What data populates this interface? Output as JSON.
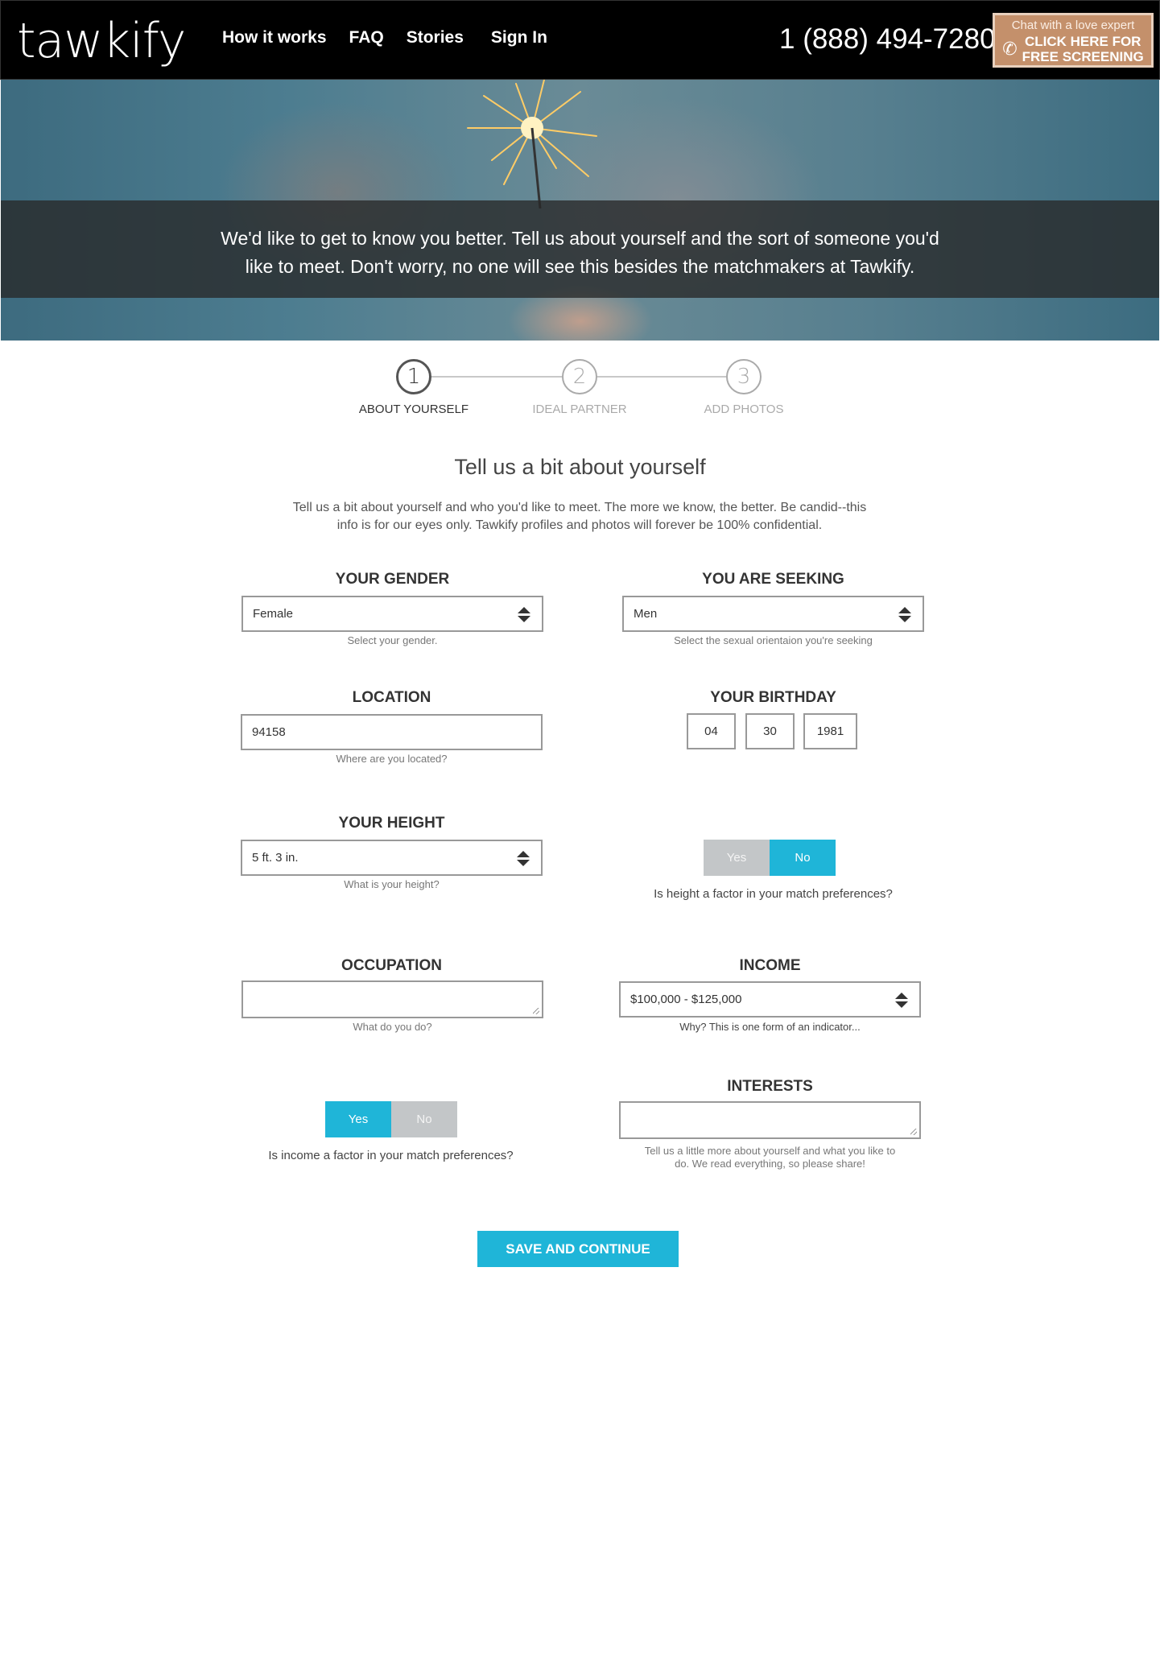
{
  "header": {
    "logo": "tawkify",
    "nav": [
      "How it works",
      "FAQ",
      "Stories",
      "Sign In"
    ],
    "phone": "1 (888) 494-7280",
    "cta_top": "Chat with a love expert",
    "cta_line1": "CLICK HERE FOR",
    "cta_line2": "FREE SCREENING",
    "cta_color": "#c4906b"
  },
  "hero": {
    "line1": "We'd like to get to know you better. Tell us about yourself and the sort of someone you'd",
    "line2": "like to meet. Don't worry, no one will see this besides the matchmakers at Tawkify."
  },
  "steps": [
    {
      "number": "1",
      "label": "ABOUT YOURSELF",
      "active": true
    },
    {
      "number": "2",
      "label": "IDEAL PARTNER",
      "active": false
    },
    {
      "number": "3",
      "label": "ADD PHOTOS",
      "active": false
    }
  ],
  "intro": {
    "title": "Tell us a bit about yourself",
    "desc_line1": "Tell us a bit about yourself and who you'd like to meet. The more we know, the better. Be candid--this",
    "desc_line2": "info is for our eyes only. Tawkify profiles and photos will forever be 100% confidential."
  },
  "form": {
    "gender": {
      "label": "YOUR GENDER",
      "value": "Female",
      "help": "Select your gender."
    },
    "seeking": {
      "label": "YOU ARE SEEKING",
      "value": "Men",
      "help": "Select the sexual orientaion you're seeking"
    },
    "location": {
      "label": "LOCATION",
      "value": "94158",
      "help": "Where are you located?"
    },
    "birthday": {
      "label": "YOUR BIRTHDAY",
      "month": "04",
      "day": "30",
      "year": "1981"
    },
    "height": {
      "label": "YOUR HEIGHT",
      "value": "5 ft. 3 in.",
      "help": "What is your height?"
    },
    "height_factor": {
      "yes": "Yes",
      "no": "No",
      "selected": "No",
      "question": "Is height a factor in your match preferences?"
    },
    "occupation": {
      "label": "OCCUPATION",
      "value": "",
      "help": "What do you do?"
    },
    "income": {
      "label": "INCOME",
      "value": "$100,000 - $125,000",
      "help": "Why? This is one form of an indicator..."
    },
    "income_factor": {
      "yes": "Yes",
      "no": "No",
      "selected": "Yes",
      "question": "Is income a factor in your match preferences?"
    },
    "interests": {
      "label": "INTERESTS",
      "value": "",
      "help_line1": "Tell us a little more about yourself and what you like to",
      "help_line2": "do. We read everything, so please share!"
    }
  },
  "save_button": "SAVE AND CONTINUE",
  "accent_color": "#1fb5d8"
}
